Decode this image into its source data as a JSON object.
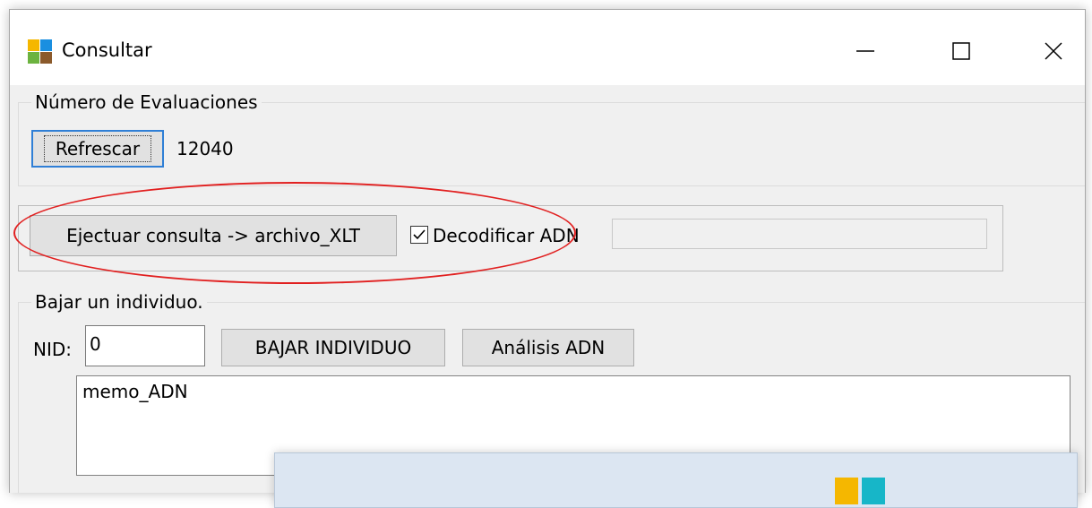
{
  "window": {
    "title": "Consultar",
    "icon": "app-four-color-icon",
    "controls": [
      "minimize-icon",
      "maximize-icon",
      "close-icon"
    ]
  },
  "evaluaciones": {
    "group_label": "Número de Evaluaciones",
    "refresh_label": "Refrescar",
    "count": "12040"
  },
  "query": {
    "run_label": "Ejectuar consulta -> archivo_XLT",
    "decode_label": "Decodificar ADN",
    "decode_checked": true,
    "status_value": ""
  },
  "individual": {
    "group_label": "Bajar un individuo.",
    "nid_label": "NID:",
    "nid_value": "0",
    "download_label": "BAJAR INDIVIDUO",
    "analysis_label": "Análisis ADN",
    "memo_text": "memo_ADN"
  },
  "colors": {
    "focus_blue": "#2f7fd6",
    "annotation_red": "#e12020"
  }
}
